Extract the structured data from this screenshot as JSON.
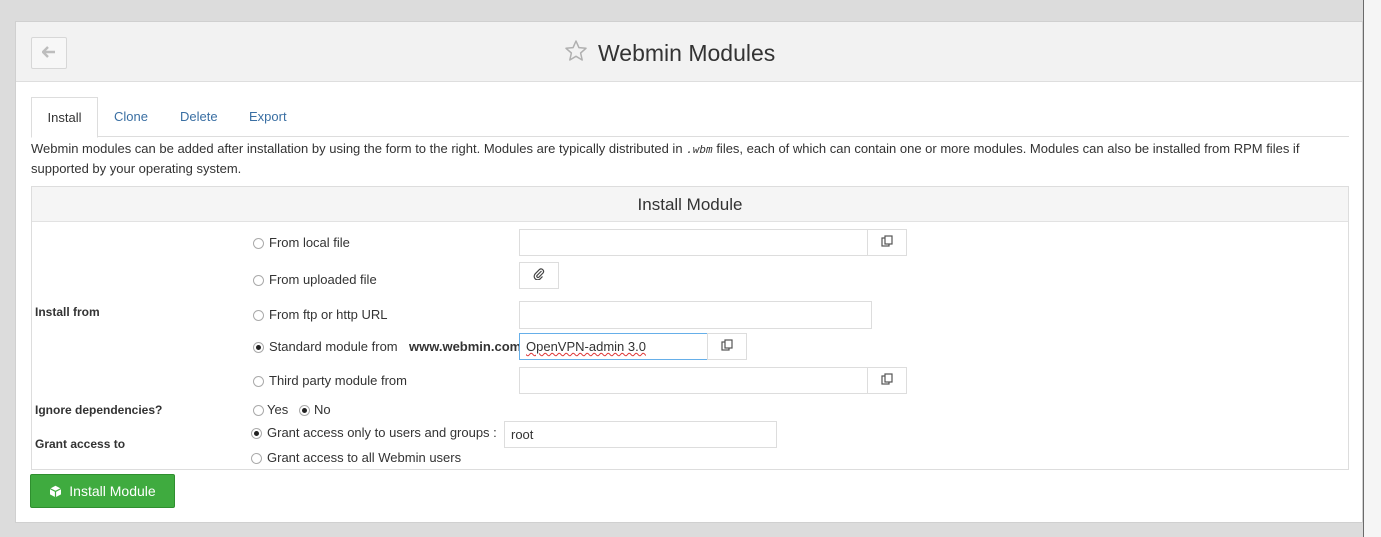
{
  "header": {
    "title": "Webmin Modules",
    "back_icon": "arrow-left-icon",
    "star_icon": "star-outline-icon"
  },
  "tabs": [
    {
      "label": "Install",
      "active": true
    },
    {
      "label": "Clone",
      "active": false
    },
    {
      "label": "Delete",
      "active": false
    },
    {
      "label": "Export",
      "active": false
    }
  ],
  "description": {
    "part1": "Webmin modules can be added after installation by using the form to the right. Modules are typically distributed in",
    "code": ".wbm",
    "part2": "files, each of which can contain one or more modules. Modules can also be installed from RPM files if supported by your operating system."
  },
  "form": {
    "title": "Install Module",
    "install_from": {
      "label": "Install from",
      "options": {
        "local_file": {
          "label": "From local file",
          "selected": false,
          "value": ""
        },
        "uploaded_file": {
          "label": "From uploaded file",
          "selected": false
        },
        "url": {
          "label": "From ftp or http URL",
          "selected": false,
          "value": ""
        },
        "standard": {
          "label": "Standard module from",
          "site": "www.webmin.com",
          "selected": true,
          "value": "OpenVPN-admin 3.0"
        },
        "third_party": {
          "label": "Third party module from",
          "selected": false,
          "value": ""
        }
      }
    },
    "ignore_deps": {
      "label": "Ignore dependencies?",
      "yes": "Yes",
      "no": "No",
      "selected": "No"
    },
    "grant_access": {
      "label": "Grant access to",
      "only_label": "Grant access only to users and groups :",
      "only_value": "root",
      "all_label": "Grant access to all Webmin users",
      "selected": "only"
    }
  },
  "install_button": {
    "label": "Install Module",
    "icon": "cube-icon",
    "color": "#3fab3f"
  }
}
